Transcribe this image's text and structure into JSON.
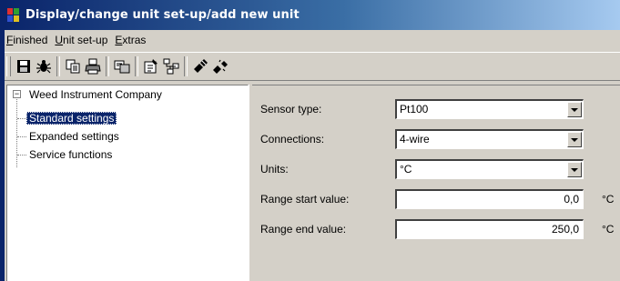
{
  "window": {
    "title": "Display/change unit set-up/add new unit"
  },
  "menu": [
    {
      "label": "Finished",
      "mnemonic": "F",
      "rest": "inished"
    },
    {
      "label": "Unit set-up",
      "mnemonic": "U",
      "rest": "nit set-up"
    },
    {
      "label": "Extras",
      "mnemonic": "E",
      "rest": "xtras"
    }
  ],
  "toolbar": {
    "icons": [
      "save-icon",
      "bug-icon",
      "copy-icon",
      "print-icon",
      "transfer-icon",
      "properties-icon",
      "network-icon",
      "connect-icon",
      "disconnect-icon"
    ]
  },
  "tree": {
    "root": "Weed Instrument Company",
    "expander": "−",
    "children": [
      {
        "label": "Standard settings",
        "selected": true
      },
      {
        "label": "Expanded settings",
        "selected": false
      },
      {
        "label": "Service functions",
        "selected": false
      }
    ]
  },
  "form": {
    "sensor_type": {
      "label": "Sensor type:",
      "value": "Pt100"
    },
    "connections": {
      "label": "Connections:",
      "value": "4-wire"
    },
    "units": {
      "label": "Units:",
      "value": "°C"
    },
    "range_start": {
      "label": "Range start value:",
      "value": "0,0",
      "unit": "°C"
    },
    "range_end": {
      "label": "Range end value:",
      "value": "250,0",
      "unit": "°C"
    }
  },
  "colors": {
    "title_start": "#0a246a",
    "title_end": "#a6caf0",
    "face": "#d4d0c8",
    "selection": "#0a246a"
  }
}
